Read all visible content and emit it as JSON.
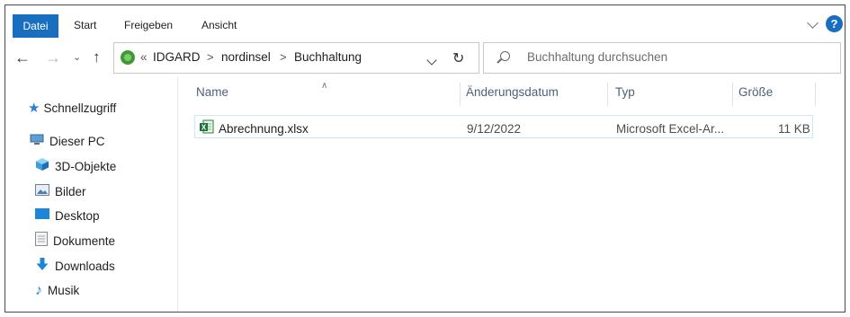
{
  "ribbon": {
    "tabs": [
      "Datei",
      "Start",
      "Freigeben",
      "Ansicht"
    ],
    "help_label": "?"
  },
  "address": {
    "overflow": "«",
    "path": [
      "IDGARD",
      "nordinsel",
      "Buchhaltung"
    ],
    "separator": ">"
  },
  "search": {
    "placeholder": "Buchhaltung durchsuchen"
  },
  "sidebar": {
    "items": [
      {
        "label": "Schnellzugriff",
        "icon": "star-icon"
      },
      {
        "label": "Dieser PC",
        "icon": "computer-icon"
      },
      {
        "label": "3D-Objekte",
        "icon": "cube-icon"
      },
      {
        "label": "Bilder",
        "icon": "pictures-icon"
      },
      {
        "label": "Desktop",
        "icon": "desktop-icon"
      },
      {
        "label": "Dokumente",
        "icon": "documents-icon"
      },
      {
        "label": "Downloads",
        "icon": "download-arrow-icon"
      },
      {
        "label": "Musik",
        "icon": "music-note-icon"
      }
    ]
  },
  "file_list": {
    "columns": [
      "Name",
      "Änderungsdatum",
      "Typ",
      "Größe"
    ],
    "rows": [
      {
        "name": "Abrechnung.xlsx",
        "date": "9/12/2022",
        "type": "Microsoft Excel-Ar...",
        "size": "11 KB",
        "icon": "excel-file-icon"
      }
    ]
  },
  "colors": {
    "accent": "#1a6ec0",
    "selection_border": "#cce8ff",
    "header_text": "#4c607a"
  }
}
